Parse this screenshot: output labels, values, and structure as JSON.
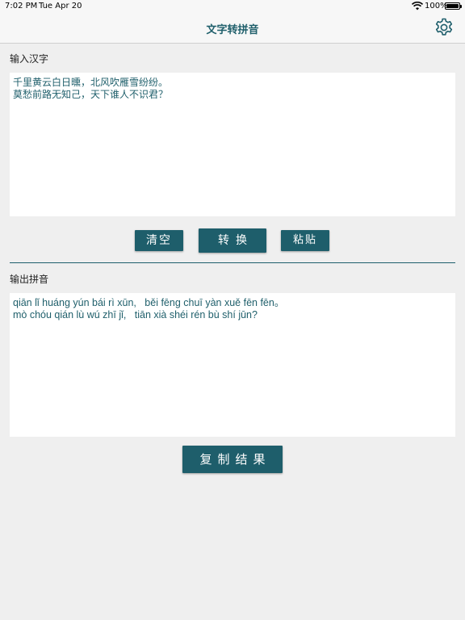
{
  "status_bar": {
    "time": "7:02 PM",
    "date": "Tue Apr 20",
    "battery_percent": "100%",
    "battery_level": 1.0,
    "wifi_icon": "wifi-icon"
  },
  "nav": {
    "title": "文字转拼音",
    "settings_icon": "gear-icon"
  },
  "input_section": {
    "label": "输入汉字",
    "text": "千里黄云白日曛，北风吹雁雪纷纷。\n莫愁前路无知己，天下谁人不识君？"
  },
  "buttons": {
    "clear": "清空",
    "convert": "转换",
    "paste": "粘贴",
    "copy": "复制结果"
  },
  "output_section": {
    "label": "输出拼音",
    "text": "qiān lǐ huáng yún bái rì xūn,   běi fēng chuī yàn xuě fēn fēn。\nmò chóu qián lù wú zhī jǐ,   tiān xià shéi rén bù shí jūn?"
  },
  "colors": {
    "accent": "#1e5e6b",
    "background": "#efefef",
    "box": "#ffffff"
  }
}
